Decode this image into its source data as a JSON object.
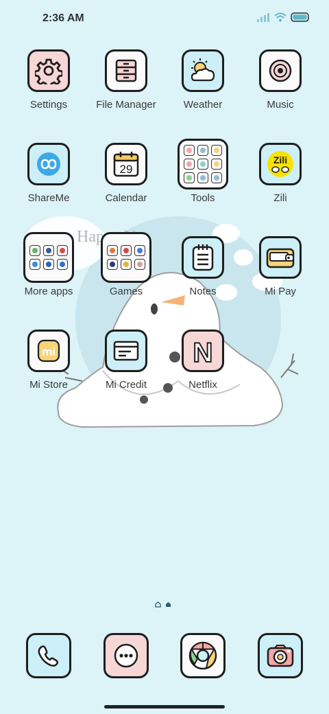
{
  "status_bar": {
    "time": "2:36 AM"
  },
  "wallpaper": {
    "banner_text": "Happy Yea"
  },
  "apps": [
    {
      "label": "Settings",
      "icon": "gear-icon",
      "bg": "#f7d6d6"
    },
    {
      "label": "File Manager",
      "icon": "drawer-icon",
      "bg": "#fbfbfb"
    },
    {
      "label": "Weather",
      "icon": "sun-cloud-icon",
      "bg": "#cdeff7"
    },
    {
      "label": "Music",
      "icon": "disc-icon",
      "bg": "#fbfbfb"
    },
    {
      "label": "ShareMe",
      "icon": "infinity-icon",
      "bg": "#cdeff7"
    },
    {
      "label": "Calendar",
      "icon": "calendar-icon",
      "bg": "#fbfbfb",
      "day": "29"
    },
    {
      "label": "Tools",
      "icon": "folder-icon",
      "bg": "#fbfbfb"
    },
    {
      "label": "Zili",
      "icon": "zili-icon",
      "bg": "#cdeff7",
      "badge": "Zili"
    },
    {
      "label": "More apps",
      "icon": "folder-icon",
      "bg": "#fbfbfb"
    },
    {
      "label": "Games",
      "icon": "folder-icon",
      "bg": "#fbfbfb"
    },
    {
      "label": "Notes",
      "icon": "notepad-icon",
      "bg": "#cdeff7"
    },
    {
      "label": "Mi Pay",
      "icon": "wallet-icon",
      "bg": "#cdeff7"
    },
    {
      "label": "Mi Store",
      "icon": "mi-logo-icon",
      "bg": "#fbfbfb",
      "logo": "mi"
    },
    {
      "label": "Mi Credit",
      "icon": "card-icon",
      "bg": "#cdeff7"
    },
    {
      "label": "Netflix",
      "icon": "netflix-icon",
      "bg": "#f7d6d6",
      "logo": "N"
    }
  ],
  "dock": [
    {
      "name": "phone",
      "icon": "phone-icon",
      "bg": "#cdeff7"
    },
    {
      "name": "messages",
      "icon": "chat-dots-icon",
      "bg": "#f7d6d6"
    },
    {
      "name": "browser",
      "icon": "chrome-icon",
      "bg": "#fbfbfb"
    },
    {
      "name": "camera",
      "icon": "camera-icon",
      "bg": "#cdeff7"
    }
  ],
  "colors": {
    "background": "#dcf3f8",
    "outline": "#1e1e1e",
    "label": "#3a3a3a"
  }
}
